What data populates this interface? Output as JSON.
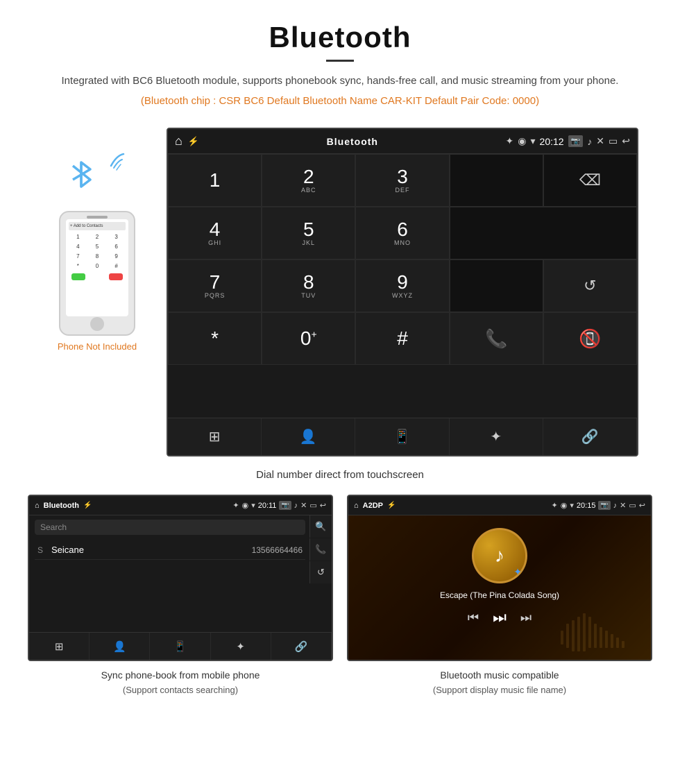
{
  "header": {
    "title": "Bluetooth",
    "description": "Integrated with BC6 Bluetooth module, supports phonebook sync, hands-free call, and music streaming from your phone.",
    "specs": "(Bluetooth chip : CSR BC6    Default Bluetooth Name CAR-KIT    Default Pair Code: 0000)"
  },
  "phone_label": "Phone Not Included",
  "dial_caption": "Dial number direct from touchscreen",
  "statusbar": {
    "app_name": "Bluetooth",
    "time": "20:12"
  },
  "dialpad": {
    "keys": [
      {
        "num": "1",
        "sub": ""
      },
      {
        "num": "2",
        "sub": "ABC"
      },
      {
        "num": "3",
        "sub": "DEF"
      },
      {
        "num": "4",
        "sub": "GHI"
      },
      {
        "num": "5",
        "sub": "JKL"
      },
      {
        "num": "6",
        "sub": "MNO"
      },
      {
        "num": "7",
        "sub": "PQRS"
      },
      {
        "num": "8",
        "sub": "TUV"
      },
      {
        "num": "9",
        "sub": "WXYZ"
      },
      {
        "num": "*",
        "sub": ""
      },
      {
        "num": "0",
        "sub": "+"
      },
      {
        "num": "#",
        "sub": ""
      }
    ]
  },
  "phonebook": {
    "statusbar": {
      "app_name": "Bluetooth",
      "time": "20:11"
    },
    "search_placeholder": "Search",
    "contact_letter": "S",
    "contact_name": "Seicane",
    "contact_number": "13566664466",
    "caption": "Sync phone-book from mobile phone",
    "caption_sub": "(Support contacts searching)"
  },
  "music": {
    "statusbar": {
      "app_name": "A2DP",
      "time": "20:15"
    },
    "song_title": "Escape (The Pina Colada Song)",
    "caption": "Bluetooth music compatible",
    "caption_sub": "(Support display music file name)"
  }
}
